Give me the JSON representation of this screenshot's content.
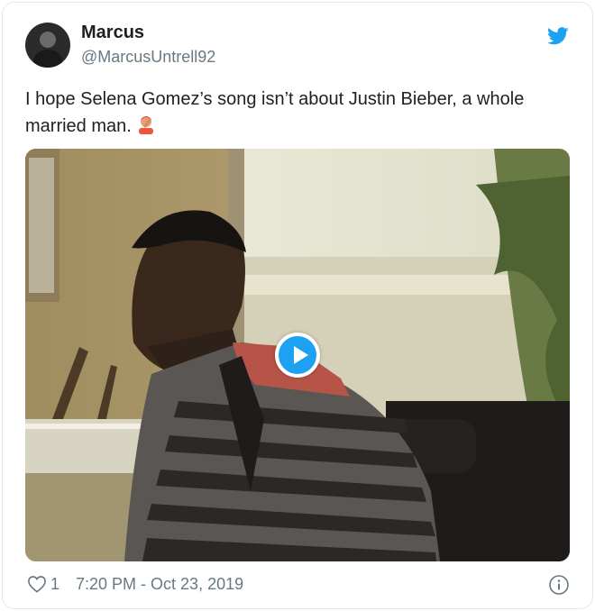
{
  "author": {
    "display_name": "Marcus",
    "handle": "@MarcusUntrell92"
  },
  "tweet": {
    "text": "I hope Selena Gomez’s song isn’t about Justin Bieber, a whole married man.",
    "emoji": "facepalm-emoji"
  },
  "media": {
    "type": "video",
    "play_icon": "play-icon"
  },
  "footer": {
    "like_count": "1",
    "timestamp": "7:20 PM - Oct 23, 2019",
    "info_icon": "info-icon",
    "heart_icon": "heart-icon"
  },
  "brand": {
    "logo": "twitter-bird-icon",
    "accent": "#1da1f2"
  }
}
